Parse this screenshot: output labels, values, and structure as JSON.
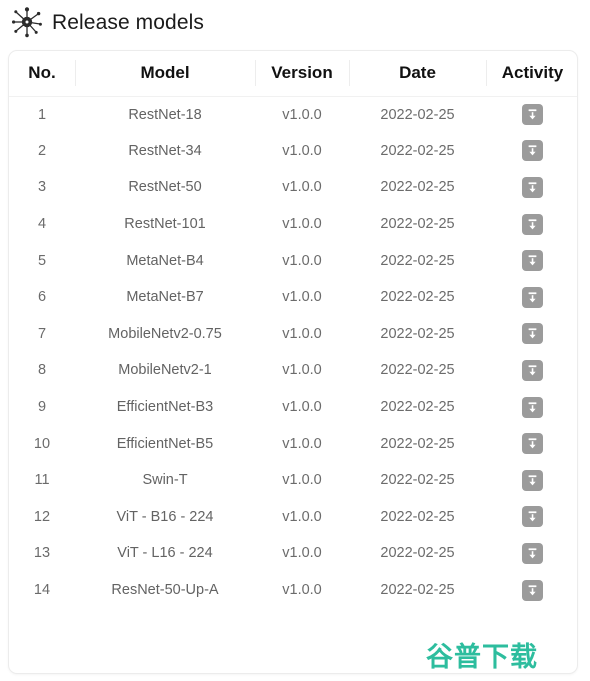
{
  "header": {
    "title": "Release models",
    "icon": "network-nodes-icon"
  },
  "table": {
    "columns": [
      {
        "key": "no",
        "label": "No."
      },
      {
        "key": "model",
        "label": "Model"
      },
      {
        "key": "version",
        "label": "Version"
      },
      {
        "key": "date",
        "label": "Date"
      },
      {
        "key": "activity",
        "label": "Activity"
      }
    ],
    "action_icon": "download-icon",
    "rows": [
      {
        "no": "1",
        "model": "RestNet-18",
        "version": "v1.0.0",
        "date": "2022-02-25"
      },
      {
        "no": "2",
        "model": "RestNet-34",
        "version": "v1.0.0",
        "date": "2022-02-25"
      },
      {
        "no": "3",
        "model": "RestNet-50",
        "version": "v1.0.0",
        "date": "2022-02-25"
      },
      {
        "no": "4",
        "model": "RestNet-101",
        "version": "v1.0.0",
        "date": "2022-02-25"
      },
      {
        "no": "5",
        "model": "MetaNet-B4",
        "version": "v1.0.0",
        "date": "2022-02-25"
      },
      {
        "no": "6",
        "model": "MetaNet-B7",
        "version": "v1.0.0",
        "date": "2022-02-25"
      },
      {
        "no": "7",
        "model": "MobileNetv2-0.75",
        "version": "v1.0.0",
        "date": "2022-02-25"
      },
      {
        "no": "8",
        "model": "MobileNetv2-1",
        "version": "v1.0.0",
        "date": "2022-02-25"
      },
      {
        "no": "9",
        "model": "EfficientNet-B3",
        "version": "v1.0.0",
        "date": "2022-02-25"
      },
      {
        "no": "10",
        "model": "EfficientNet-B5",
        "version": "v1.0.0",
        "date": "2022-02-25"
      },
      {
        "no": "11",
        "model": "Swin-T",
        "version": "v1.0.0",
        "date": "2022-02-25"
      },
      {
        "no": "12",
        "model": "ViT - B16 - 224",
        "version": "v1.0.0",
        "date": "2022-02-25"
      },
      {
        "no": "13",
        "model": "ViT - L16 - 224",
        "version": "v1.0.0",
        "date": "2022-02-25"
      },
      {
        "no": "14",
        "model": "ResNet-50-Up-A",
        "version": "v1.0.0",
        "date": "2022-02-25"
      }
    ]
  },
  "watermark": {
    "text": "谷普下载",
    "color": "#2dbd9e"
  },
  "colors": {
    "accent": "#2dbd9e",
    "icon_button": "#9b9b9b",
    "text_primary": "#1b1b1b",
    "text_secondary": "#656565",
    "card_border": "#ececec"
  }
}
